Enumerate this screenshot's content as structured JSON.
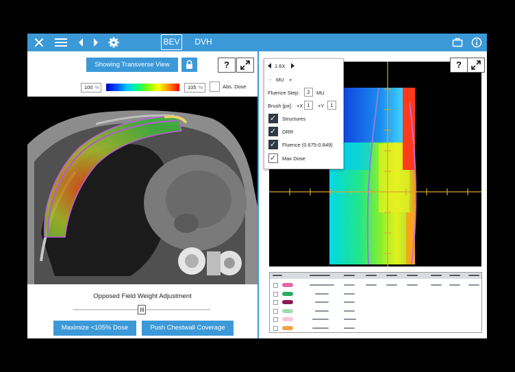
{
  "toolbar": {
    "close_icon": "close-icon",
    "menu_icon": "hamburger-icon",
    "prev_icon": "chevron-left-icon",
    "next_icon": "chevron-right-icon",
    "settings_icon": "gear-icon",
    "tabs": [
      {
        "label": "BEV",
        "active": true
      },
      {
        "label": "DVH",
        "active": false
      }
    ],
    "briefcase_icon": "briefcase-icon",
    "info_icon": "info-icon",
    "accent": "#3c99d8"
  },
  "left_panel": {
    "view_button_label": "Showing Transverse View",
    "lock_icon": "lock-icon",
    "help_label": "?",
    "dose_min_value": "100",
    "dose_max_value": "105",
    "percent_unit": "%",
    "abs_dose_label": "Abs. Dose",
    "abs_dose_checked": false,
    "slider_title": "Opposed Field Weight Adjustment",
    "slider_value": 0.5,
    "maximize_button_label": "Maximize <105% Dose",
    "push_button_label": "Push Chestwall Coverage"
  },
  "right_panel": {
    "help_label": "?",
    "popup": {
      "zoom_label": "1.6X",
      "mu_minus": "-",
      "mu_label": "MU",
      "mu_plus": "+",
      "fluence_step_label": "Fluence Step:",
      "fluence_step_value": "2",
      "fluence_step_unit": "MU",
      "brush_label": "Brush [px]:",
      "brush_x_label": "+X",
      "brush_x_value": "1",
      "brush_y_label": "+Y",
      "brush_y_value": "1",
      "options": [
        {
          "label": "Structures",
          "checked": true
        },
        {
          "label": "DRR",
          "checked": true
        },
        {
          "label": "Fluence (0.675-0.849)",
          "checked": true
        },
        {
          "label": "Max Dose",
          "checked": true
        }
      ]
    },
    "structures": [
      {
        "color": "#e0679f"
      },
      {
        "color": "#27ae60"
      },
      {
        "color": "#8b1a55"
      },
      {
        "color": "#9fdcb0"
      },
      {
        "color": "#f5c6d6"
      },
      {
        "color": "#f0a24a"
      }
    ]
  }
}
